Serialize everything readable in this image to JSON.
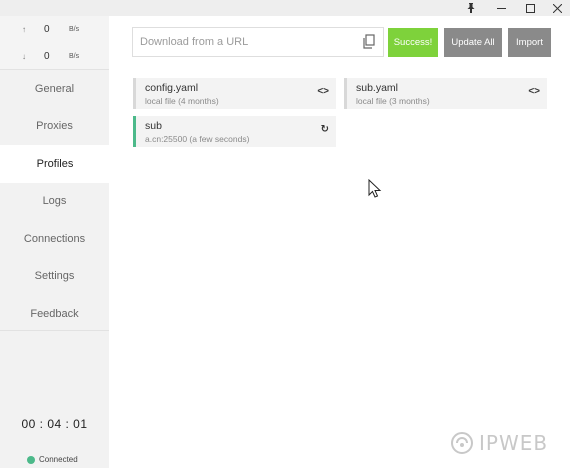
{
  "titlebar": {
    "pin_icon": "pin-icon",
    "minimize_icon": "minimize-icon",
    "maximize_icon": "maximize-icon",
    "close_icon": "close-icon"
  },
  "traffic": {
    "upload": {
      "arrow": "↑",
      "value": "0",
      "unit": "B/s"
    },
    "download": {
      "arrow": "↓",
      "value": "0",
      "unit": "B/s"
    }
  },
  "nav": {
    "items": [
      {
        "label": "General",
        "active": false
      },
      {
        "label": "Proxies",
        "active": false
      },
      {
        "label": "Profiles",
        "active": true
      },
      {
        "label": "Logs",
        "active": false
      },
      {
        "label": "Connections",
        "active": false
      },
      {
        "label": "Settings",
        "active": false
      },
      {
        "label": "Feedback",
        "active": false
      }
    ]
  },
  "status": {
    "timer": "00 : 04 : 01",
    "connection": "Connected",
    "dot_color": "#4cb98a"
  },
  "toolbar": {
    "url_placeholder": "Download from a URL",
    "url_value": "",
    "success_label": "Success!",
    "update_all_label": "Update All",
    "import_label": "Import"
  },
  "profiles": [
    {
      "name": "config.yaml",
      "meta": "local file (4 months)",
      "action": "<>",
      "active": false
    },
    {
      "name": "sub.yaml",
      "meta": "local file (3 months)",
      "action": "<>",
      "active": false
    },
    {
      "name": "sub",
      "meta": "a.cn:25500 (a few seconds)",
      "action": "↻",
      "active": true
    }
  ],
  "colors": {
    "accent": "#4cb98a",
    "success": "#7ed23b",
    "button_gray": "#8a8a8a",
    "sidebar_bg": "#f2f2f2"
  },
  "watermark": {
    "text": "IPWEB"
  }
}
